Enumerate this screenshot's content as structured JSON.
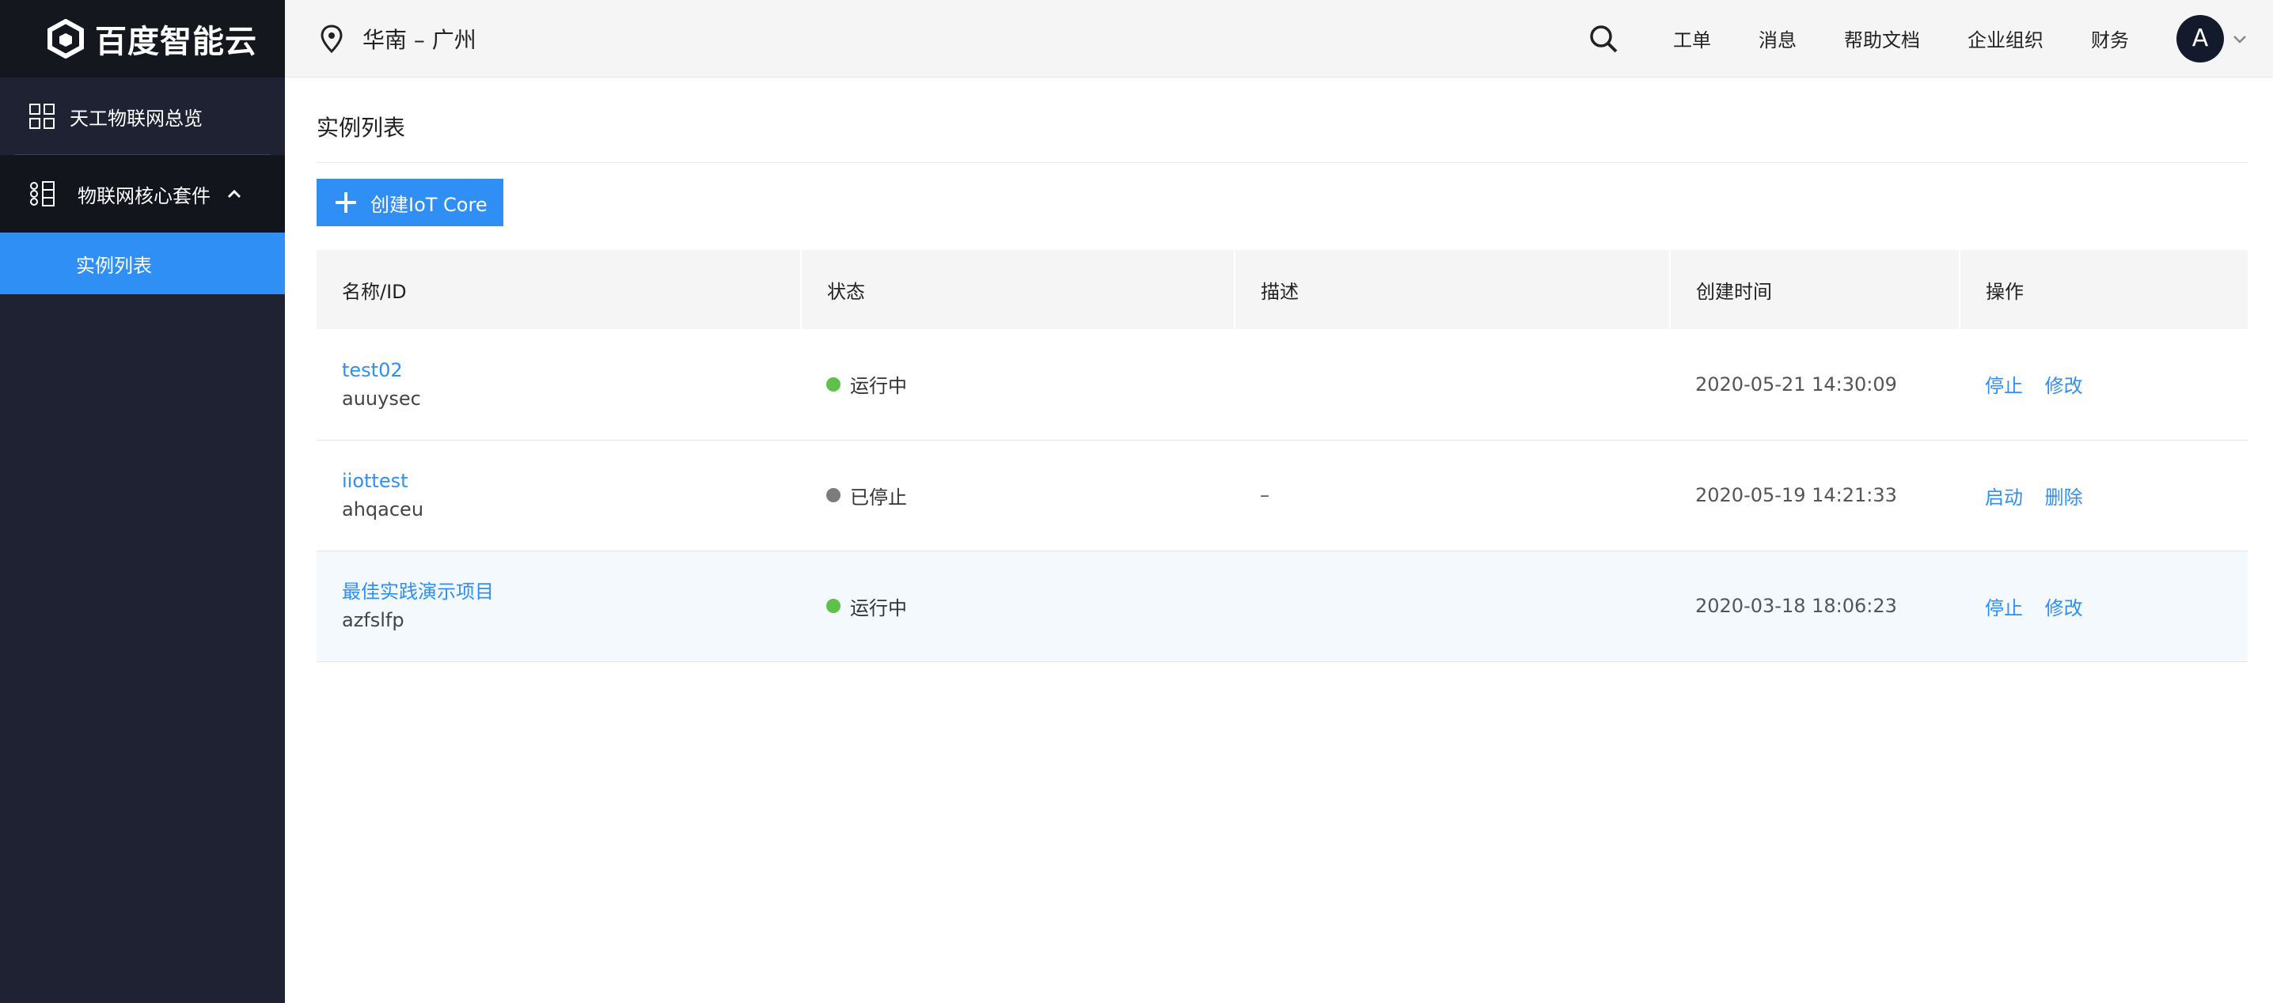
{
  "sidebar": {
    "logo_text": "百度智能云",
    "overview_label": "天工物联网总览",
    "group_label": "物联网核心套件",
    "sub_item_label": "实例列表"
  },
  "topbar": {
    "region": "华南 – 广州",
    "nav": [
      "工单",
      "消息",
      "帮助文档",
      "企业组织",
      "财务"
    ],
    "avatar_letter": "A"
  },
  "main": {
    "title": "实例列表",
    "create_button": "创建IoT Core",
    "columns": [
      "名称/ID",
      "状态",
      "描述",
      "创建时间",
      "操作"
    ],
    "rows": [
      {
        "name": "test02",
        "id": "auuysec",
        "status": "运行中",
        "status_type": "running",
        "desc": "",
        "created": "2020-05-21 14:30:09",
        "actions": [
          "停止",
          "修改"
        ]
      },
      {
        "name": "iiottest",
        "id": "ahqaceu",
        "status": "已停止",
        "status_type": "stopped",
        "desc": "–",
        "created": "2020-05-19 14:21:33",
        "actions": [
          "启动",
          "删除"
        ]
      },
      {
        "name": "最佳实践演示项目",
        "id": "azfslfp",
        "status": "运行中",
        "status_type": "running",
        "desc": "",
        "created": "2020-03-18 18:06:23",
        "actions": [
          "停止",
          "修改"
        ]
      }
    ]
  },
  "colors": {
    "accent": "#2f8ff5",
    "sidebar_bg": "#1f2232",
    "running": "#5ec24a",
    "stopped": "#7c7c7c"
  }
}
